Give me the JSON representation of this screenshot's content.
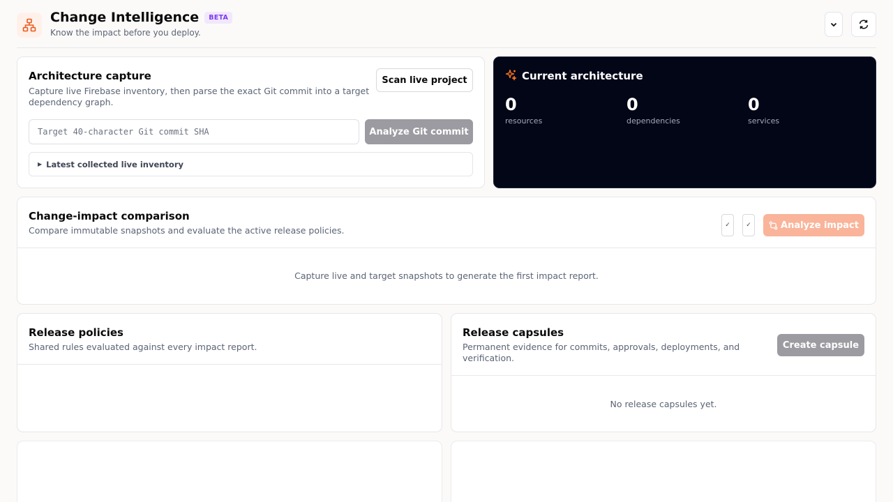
{
  "header": {
    "title": "Change Intelligence",
    "badge": "BETA",
    "subtitle": "Know the impact before you deploy."
  },
  "capture": {
    "title": "Architecture capture",
    "description": "Capture live Firebase inventory, then parse the exact Git commit into a target dependency graph.",
    "scan_button": "Scan live project",
    "commit_placeholder": "Target 40-character Git commit SHA",
    "commit_value": "",
    "analyze_commit_button": "Analyze Git commit",
    "inventory_label": "Latest collected live inventory"
  },
  "architecture": {
    "title": "Current architecture",
    "stats": [
      {
        "value": "0",
        "label": "resources"
      },
      {
        "value": "0",
        "label": "dependencies"
      },
      {
        "value": "0",
        "label": "services"
      }
    ]
  },
  "comparison": {
    "title": "Change-impact comparison",
    "description": "Compare immutable snapshots and evaluate the active release policies.",
    "analyze_button": "Analyze impact",
    "empty": "Capture live and target snapshots to generate the first impact report."
  },
  "policies": {
    "title": "Release policies",
    "description": "Shared rules evaluated against every impact report."
  },
  "capsules": {
    "title": "Release capsules",
    "description": "Permanent evidence for commits, approvals, deployments, and verification.",
    "create_button": "Create capsule",
    "empty": "No release capsules yet."
  },
  "colors": {
    "accent": "#ea5a1f",
    "dark_panel": "#030617",
    "disabled": "#9b9ba1",
    "beta_text": "#7c3aed"
  }
}
